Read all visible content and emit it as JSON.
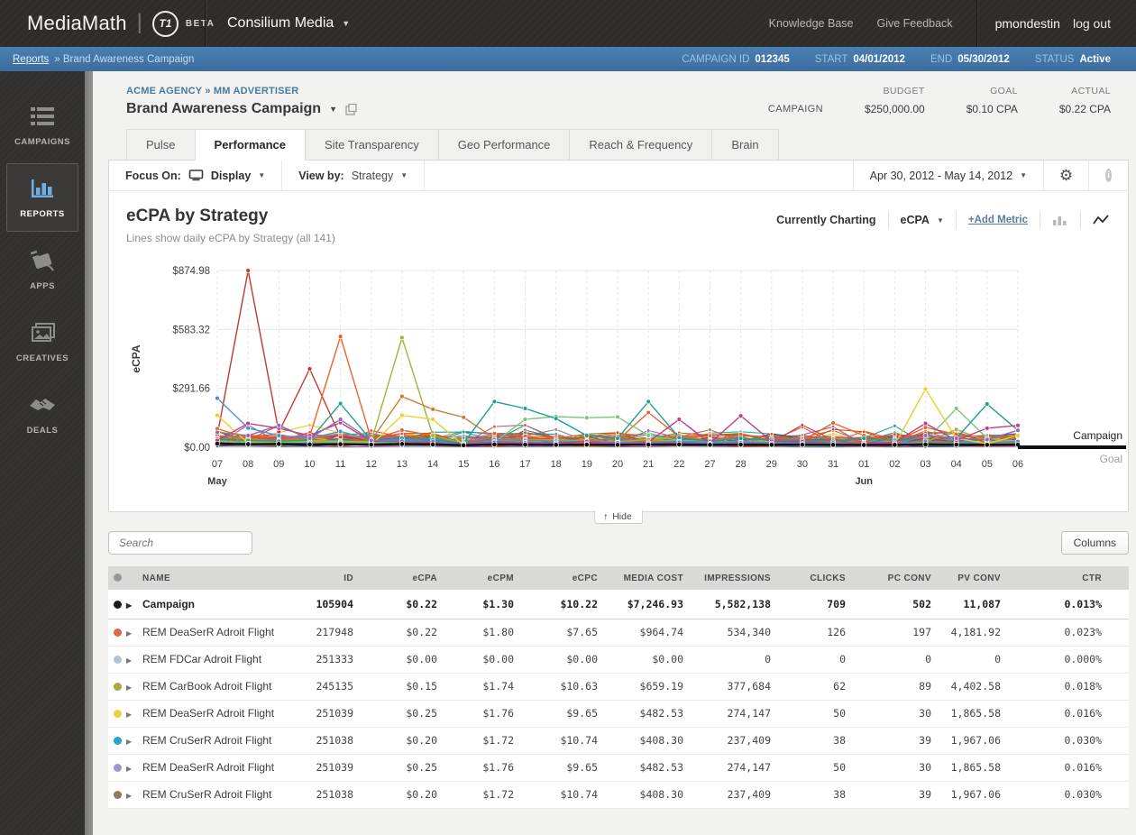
{
  "header": {
    "brand": "MediaMath",
    "logo_badge": "T1",
    "beta": "BETA",
    "org_selector": "Consilium Media",
    "links": [
      "Knowledge Base",
      "Give Feedback"
    ],
    "username": "pmondestin",
    "logout": "log out"
  },
  "breadcrumb_bar": {
    "link": "Reports",
    "rest": "» Brand Awareness Campaign",
    "meta": [
      {
        "label": "CAMPAIGN ID",
        "value": "012345"
      },
      {
        "label": "START",
        "value": "04/01/2012"
      },
      {
        "label": "END",
        "value": "05/30/2012"
      },
      {
        "label": "STATUS",
        "value": "Active"
      }
    ]
  },
  "sidebar": {
    "items": [
      {
        "label": "CAMPAIGNS",
        "icon": "list-icon",
        "active": false
      },
      {
        "label": "REPORTS",
        "icon": "bar-chart-icon",
        "active": true
      },
      {
        "label": "APPS",
        "icon": "plug-icon",
        "active": false
      },
      {
        "label": "CREATIVES",
        "icon": "image-icon",
        "active": false
      },
      {
        "label": "DEALS",
        "icon": "handshake-icon",
        "active": false
      }
    ]
  },
  "campaign_header": {
    "breadcrumb": "ACME AGENCY » MM ADVERTISER",
    "title": "Brand Awareness Campaign",
    "row_label": "CAMPAIGN",
    "stats": [
      {
        "label": "BUDGET",
        "value": "$250,000.00"
      },
      {
        "label": "GOAL",
        "value": "$0.10 CPA"
      },
      {
        "label": "ACTUAL",
        "value": "$0.22 CPA"
      }
    ]
  },
  "tabs": [
    {
      "label": "Pulse",
      "active": false
    },
    {
      "label": "Performance",
      "active": true
    },
    {
      "label": "Site Transparency",
      "active": false
    },
    {
      "label": "Geo Performance",
      "active": false
    },
    {
      "label": "Reach & Frequency",
      "active": false
    },
    {
      "label": "Brain",
      "active": false
    }
  ],
  "toolbar": {
    "focus_label": "Focus On:",
    "focus_value": "Display",
    "viewby_label": "View by:",
    "viewby_value": "Strategy",
    "date_range": "Apr 30, 2012 - May 14, 2012",
    "gear_icon": "gear",
    "info_icon": "i"
  },
  "chart": {
    "title": "eCPA by Strategy",
    "subtitle": "Lines show daily eCPA by Strategy (all 141)",
    "currently_charting_label": "Currently Charting",
    "metric": "eCPA",
    "add_metric": "+Add Metric"
  },
  "chart_data": {
    "type": "line",
    "title": "eCPA by Strategy",
    "ylabel": "eCPA",
    "y_ticks": [
      {
        "value": 874.98,
        "label": "$874.98"
      },
      {
        "value": 583.32,
        "label": "$583.32"
      },
      {
        "value": 291.66,
        "label": "$291.66"
      },
      {
        "value": 0,
        "label": "$0.00"
      }
    ],
    "y_max": 874.98,
    "x": [
      "07",
      "08",
      "09",
      "10",
      "11",
      "12",
      "13",
      "14",
      "15",
      "16",
      "17",
      "18",
      "19",
      "20",
      "21",
      "22",
      "27",
      "28",
      "29",
      "30",
      "31",
      "01",
      "02",
      "03",
      "04",
      "05",
      "06"
    ],
    "month_markers": [
      {
        "index": 0,
        "label": "May"
      },
      {
        "index": 21,
        "label": "Jun"
      }
    ],
    "right_labels": {
      "campaign": "Campaign",
      "goal": "Goal"
    },
    "grid": true,
    "series": [
      {
        "name": "strategy-red",
        "color": "#c0392b",
        "values": [
          58,
          874.98,
          75,
          388,
          52,
          36,
          30,
          22,
          8,
          24,
          18,
          22,
          12,
          25,
          18,
          12,
          18,
          22,
          30,
          18,
          12,
          8,
          12,
          45,
          25,
          18,
          20
        ]
      },
      {
        "name": "strategy-orange",
        "color": "#e8632c",
        "values": [
          92,
          45,
          34,
          54,
          548,
          38,
          85,
          58,
          12,
          68,
          54,
          46,
          62,
          34,
          172,
          52,
          22,
          64,
          44,
          34,
          120,
          58,
          28,
          98,
          64,
          46,
          54
        ]
      },
      {
        "name": "strategy-darkorange",
        "color": "#c8802f",
        "values": [
          60,
          40,
          30,
          44,
          68,
          34,
          252,
          188,
          148,
          44,
          38,
          34,
          30,
          28,
          25,
          58,
          20,
          25,
          22,
          28,
          26,
          20,
          18,
          25,
          22,
          20,
          18
        ]
      },
      {
        "name": "strategy-olive",
        "color": "#a2b23b",
        "values": [
          44,
          30,
          25,
          34,
          30,
          28,
          543,
          58,
          20,
          30,
          34,
          38,
          30,
          28,
          38,
          30,
          25,
          28,
          22,
          25,
          20,
          18,
          20,
          25,
          88,
          30,
          25
        ]
      },
      {
        "name": "strategy-green",
        "color": "#7cc47c",
        "values": [
          30,
          25,
          20,
          28,
          25,
          22,
          30,
          28,
          15,
          25,
          138,
          152,
          146,
          150,
          58,
          34,
          25,
          30,
          28,
          25,
          22,
          20,
          18,
          30,
          192,
          45,
          30
        ]
      },
      {
        "name": "strategy-blue",
        "color": "#4a8fd4",
        "values": [
          243,
          95,
          58,
          44,
          78,
          38,
          34,
          30,
          18,
          38,
          34,
          30,
          28,
          25,
          22,
          30,
          25,
          28,
          22,
          25,
          20,
          18,
          22,
          30,
          25,
          20,
          28
        ]
      },
      {
        "name": "strategy-teal",
        "color": "#1f9e93",
        "values": [
          40,
          34,
          30,
          36,
          216,
          34,
          44,
          38,
          20,
          226,
          192,
          142,
          58,
          44,
          226,
          48,
          30,
          44,
          38,
          34,
          30,
          44,
          34,
          58,
          44,
          214,
          84
        ]
      },
      {
        "name": "strategy-yellow",
        "color": "#e6d02e",
        "values": [
          158,
          20,
          15,
          18,
          15,
          12,
          158,
          138,
          10,
          15,
          12,
          15,
          12,
          10,
          12,
          15,
          10,
          12,
          10,
          12,
          10,
          8,
          12,
          288,
          44,
          18,
          58
        ]
      },
      {
        "name": "strategy-magenta",
        "color": "#c13d88",
        "values": [
          34,
          118,
          94,
          58,
          122,
          30,
          28,
          25,
          15,
          28,
          25,
          22,
          28,
          20,
          25,
          138,
          20,
          156,
          30,
          28,
          22,
          20,
          25,
          118,
          34,
          94,
          108
        ]
      },
      {
        "name": "strategy-purple",
        "color": "#8e6bb5",
        "values": [
          74,
          58,
          108,
          44,
          138,
          34,
          30,
          28,
          12,
          25,
          22,
          20,
          18,
          22,
          20,
          25,
          18,
          22,
          20,
          18,
          22,
          15,
          18,
          58,
          44,
          38,
          84
        ]
      },
      {
        "name": "campaign",
        "color": "#111111",
        "emphasis": true,
        "values": [
          18,
          15,
          16,
          14,
          15,
          13,
          16,
          14,
          10,
          14,
          13,
          12,
          13,
          12,
          13,
          14,
          12,
          13,
          12,
          13,
          12,
          11,
          12,
          14,
          13,
          12,
          13
        ]
      }
    ],
    "background_cluster": {
      "count": 42,
      "seed": 9,
      "max": 110,
      "palette": [
        "#d35400",
        "#e74c3c",
        "#2980b9",
        "#16a085",
        "#8e44ad",
        "#f39c12",
        "#27ae60",
        "#c0392b",
        "#7f8c8d",
        "#e67e22",
        "#1abc9c",
        "#9b59b6",
        "#34495e",
        "#f1c40f",
        "#3498db",
        "#2ecc71",
        "#b5651d",
        "#888888",
        "#5d6d7e",
        "#cd6155"
      ]
    }
  },
  "table_controls": {
    "search_placeholder": "Search",
    "hide_label": "Hide",
    "columns_label": "Columns"
  },
  "table": {
    "columns": [
      "NAME",
      "ID",
      "eCPA",
      "eCPM",
      "eCPC",
      "MEDIA COST",
      "IMPRESSIONS",
      "CLICKS",
      "PC CONV",
      "PV CONV",
      "CTR"
    ],
    "rows": [
      {
        "dot": "#1d1d1f",
        "name": "Campaign",
        "bold": true,
        "cells": [
          "105904",
          "$0.22",
          "$1.30",
          "$10.22",
          "$7,246.93",
          "5,582,138",
          "709",
          "502",
          "11,087",
          "0.013%"
        ]
      },
      {
        "dot": "#e2654a",
        "name": "REM DeaSerR Adroit Flight",
        "bold": false,
        "cells": [
          "217948",
          "$0.22",
          "$1.80",
          "$7.65",
          "$964.74",
          "534,340",
          "126",
          "197",
          "4,181.92",
          "0.023%"
        ]
      },
      {
        "dot": "#a9c6d6",
        "name": "REM FDCar Adroit Flight",
        "bold": false,
        "cells": [
          "251333",
          "$0.00",
          "$0.00",
          "$0.00",
          "$0.00",
          "0",
          "0",
          "0",
          "0",
          "0.000%"
        ]
      },
      {
        "dot": "#a8a845",
        "name": "REM CarBook Adroit Flight",
        "bold": false,
        "cells": [
          "245135",
          "$0.15",
          "$1.74",
          "$10.63",
          "$659.19",
          "377,684",
          "62",
          "89",
          "4,402.58",
          "0.018%"
        ]
      },
      {
        "dot": "#ecd13d",
        "name": "REM DeaSerR Adroit Flight",
        "bold": false,
        "cells": [
          "251039",
          "$0.25",
          "$1.76",
          "$9.65",
          "$482.53",
          "274,147",
          "50",
          "30",
          "1,865.58",
          "0.016%"
        ]
      },
      {
        "dot": "#28a4c9",
        "name": "REM CruSerR Adroit Flight",
        "bold": false,
        "cells": [
          "251038",
          "$0.20",
          "$1.72",
          "$10.74",
          "$408.30",
          "237,409",
          "38",
          "39",
          "1,967.06",
          "0.030%"
        ]
      },
      {
        "dot": "#9a97d2",
        "name": "REM DeaSerR Adroit Flight",
        "bold": false,
        "cells": [
          "251039",
          "$0.25",
          "$1.76",
          "$9.65",
          "$482.53",
          "274,147",
          "50",
          "30",
          "1,865.58",
          "0.016%"
        ]
      },
      {
        "dot": "#8f7a5d",
        "name": "REM CruSerR Adroit Flight",
        "bold": false,
        "cells": [
          "251038",
          "$0.20",
          "$1.72",
          "$10.74",
          "$408.30",
          "237,409",
          "38",
          "39",
          "1,967.06",
          "0.030%"
        ]
      }
    ]
  }
}
